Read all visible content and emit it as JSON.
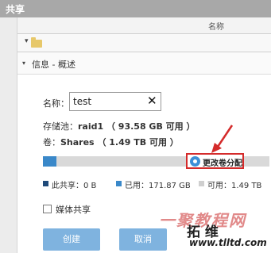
{
  "window": {
    "title": "共享"
  },
  "column_header": {
    "name": "名称"
  },
  "dialog": {
    "section_title": "信息 - 概述",
    "name_label": "名称：",
    "name_value": "test",
    "pool_label": "存储池：",
    "pool_value": "raid1 （ 93.58 GB 可用 ）",
    "volume_label": "卷：",
    "volume_value": "Shares （ 1.49 TB 可用 ）",
    "usage_fraction": 0.06,
    "change_volume_label": "更改卷分配",
    "legend": {
      "this_share": "此共享：0 B",
      "used": "已用：171.87 GB",
      "available": "可用：1.49 TB"
    },
    "media_share_label": "媒体共享",
    "media_share_checked": false,
    "create_label": "创建",
    "cancel_label": "取消"
  },
  "colors": {
    "this_share": "#1f4a7a",
    "used": "#3a88c9",
    "available": "#cfcfcf",
    "highlight": "#d42b2b"
  },
  "watermark": {
    "line1": "一聚教程网",
    "line2": "拓 维",
    "line3": "www.tlltd.com"
  }
}
